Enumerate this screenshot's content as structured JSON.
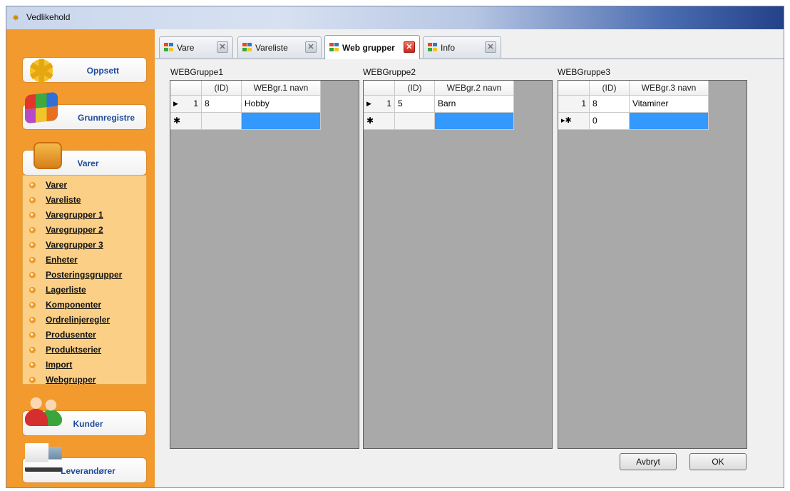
{
  "window": {
    "title": "Vedlikehold"
  },
  "sidebar": {
    "sections": [
      {
        "label": "Oppsett",
        "icon": "gear-icon"
      },
      {
        "label": "Grunnregistre",
        "icon": "blocks-icon"
      },
      {
        "label": "Varer",
        "icon": "boxes-icon"
      },
      {
        "label": "Kunder",
        "icon": "people-icon"
      },
      {
        "label": "Leverandører",
        "icon": "truck-icon"
      }
    ],
    "menu": [
      "Varer",
      "Vareliste",
      "Varegrupper 1",
      "Varegrupper 2",
      "Varegrupper 3",
      "Enheter",
      "Posteringsgrupper",
      "Lagerliste",
      "Komponenter",
      "Ordrelinjeregler",
      "Produsenter",
      "Produktserier",
      "Import",
      "Webgrupper"
    ]
  },
  "tabs": [
    {
      "label": "Vare",
      "active": false
    },
    {
      "label": "Vareliste",
      "active": false
    },
    {
      "label": "Web grupper",
      "active": true
    },
    {
      "label": "Info",
      "active": false
    }
  ],
  "grids": [
    {
      "title": "WEBGruppe1",
      "headers": [
        "(ID)",
        "WEBgr.1 navn"
      ],
      "rows": [
        {
          "indicator": "▶",
          "num": "1",
          "id": "8",
          "name": "Hobby"
        }
      ],
      "newrow": {
        "indicator": "✱",
        "id": ""
      }
    },
    {
      "title": "WEBGruppe2",
      "headers": [
        "(ID)",
        "WEBgr.2 navn"
      ],
      "rows": [
        {
          "indicator": "▶",
          "num": "1",
          "id": "5",
          "name": "Barn"
        }
      ],
      "newrow": {
        "indicator": "✱",
        "id": ""
      }
    },
    {
      "title": "WEBGruppe3",
      "headers": [
        "(ID)",
        "WEBgr.3 navn"
      ],
      "rows": [
        {
          "indicator": "",
          "num": "1",
          "id": "8",
          "name": "Vitaminer"
        }
      ],
      "newrow": {
        "indicator": "▸✱",
        "id": "0"
      }
    }
  ],
  "buttons": {
    "cancel": "Avbryt",
    "ok": "OK"
  },
  "colors": {
    "sidebar": "#f29a2e",
    "selection": "#3399ff",
    "gridbg": "#a9a9a9"
  }
}
